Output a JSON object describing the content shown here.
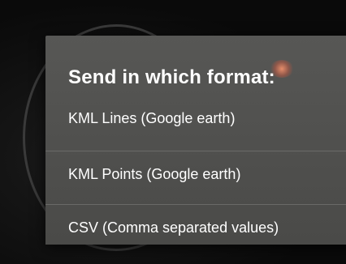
{
  "dialog": {
    "title": "Send in which format:",
    "options": [
      {
        "label": "KML Lines (Google earth)"
      },
      {
        "label": "KML Points (Google earth)"
      },
      {
        "label": "CSV (Comma separated values)"
      }
    ]
  },
  "colors": {
    "dialog_background": "#545452",
    "text": "#ffffff",
    "divider": "#6a6a68",
    "screen_background": "#0e0e0e"
  }
}
